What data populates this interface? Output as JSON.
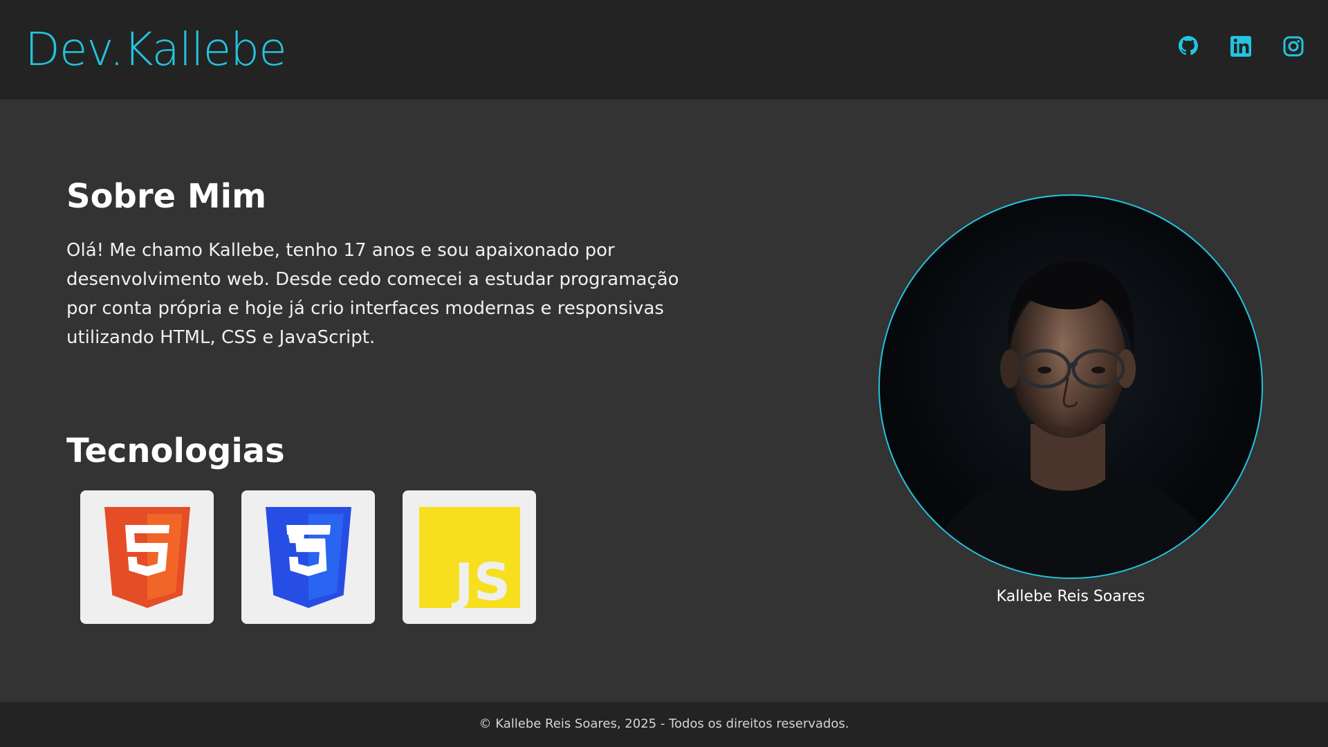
{
  "header": {
    "logo": "Dev.Kallebe",
    "social_links": [
      {
        "icon": "github-icon"
      },
      {
        "icon": "linkedin-icon"
      },
      {
        "icon": "instagram-icon"
      }
    ]
  },
  "about": {
    "title": "Sobre Mim",
    "text": "Olá! Me chamo Kallebe, tenho 17 anos e sou apaixonado por desenvolvimento web. Desde cedo comecei a estudar programação por conta própria e hoje já crio interfaces modernas e responsivas utilizando HTML, CSS e JavaScript."
  },
  "technologies": {
    "title": "Tecnologias",
    "items": [
      {
        "icon": "html5-icon",
        "color": "#e44d26"
      },
      {
        "icon": "css3-icon",
        "color": "#264de4"
      },
      {
        "icon": "javascript-icon",
        "color": "#f7df1e",
        "logo_text": "JS"
      }
    ]
  },
  "profile": {
    "caption": "Kallebe Reis Soares"
  },
  "footer": {
    "copyright": "© Kallebe Reis Soares, 2025 - Todos os direitos reservados."
  },
  "colors": {
    "accent": "#22c5e0",
    "header_bg": "#232323",
    "page_bg": "#333333",
    "card_bg": "#efefef"
  }
}
